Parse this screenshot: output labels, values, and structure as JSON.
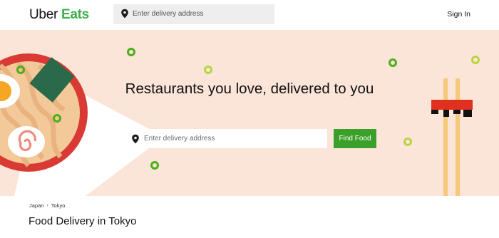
{
  "header": {
    "logo_primary": "Uber",
    "logo_secondary": "Eats",
    "search_placeholder": "Enter delivery address",
    "sign_in_label": "Sign In"
  },
  "hero": {
    "title": "Restaurants you love, delivered to you",
    "search_placeholder": "Enter delivery address",
    "find_food_label": "Find Food"
  },
  "breadcrumb": {
    "items": [
      "Japan",
      "Tokyo"
    ],
    "separator": "›"
  },
  "page_heading": "Food Delivery in Tokyo",
  "colors": {
    "brand_green": "#3bb14a",
    "button_green": "#3aa02a",
    "hero_background": "#fbe4d8"
  }
}
